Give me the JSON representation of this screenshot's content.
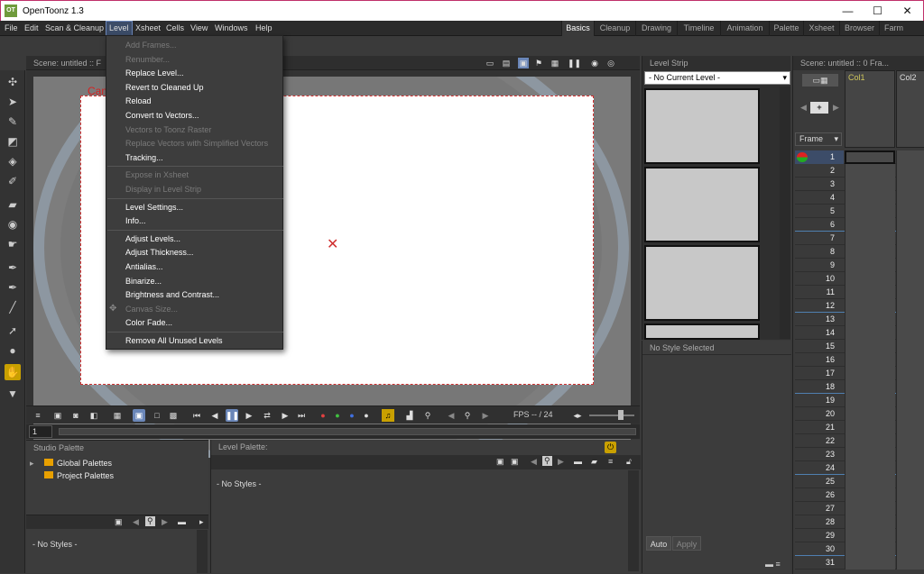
{
  "window": {
    "title": "OpenToonz 1.3",
    "logo": "OT",
    "minimize": "—",
    "maximize": "☐",
    "close": "✕"
  },
  "menubar": {
    "items": [
      "File",
      "Edit",
      "Scan & Cleanup",
      "Level",
      "Xsheet",
      "Cells",
      "View",
      "Windows",
      "Help"
    ],
    "active": "Level",
    "rooms": [
      "Basics",
      "Cleanup",
      "Drawing",
      "Timeline",
      "Animation",
      "Palette",
      "Xsheet",
      "Browser",
      "Farm"
    ],
    "active_room": "Basics"
  },
  "level_menu": {
    "groups": [
      [
        {
          "label": "Add Frames...",
          "enabled": false
        },
        {
          "label": "Renumber...",
          "enabled": false
        },
        {
          "label": "Replace Level...",
          "enabled": true
        },
        {
          "label": "Revert to Cleaned Up",
          "enabled": true
        },
        {
          "label": "Reload",
          "enabled": true
        },
        {
          "label": "Convert to Vectors...",
          "enabled": true
        },
        {
          "label": "Vectors to Toonz Raster",
          "enabled": false
        },
        {
          "label": "Replace Vectors with Simplified Vectors",
          "enabled": false
        },
        {
          "label": "Tracking...",
          "enabled": true
        }
      ],
      [
        {
          "label": "Expose in Xsheet",
          "enabled": false
        },
        {
          "label": "Display in Level Strip",
          "enabled": false
        }
      ],
      [
        {
          "label": "Level Settings...",
          "enabled": true
        },
        {
          "label": "Info...",
          "enabled": true
        }
      ],
      [
        {
          "label": "Adjust Levels...",
          "enabled": true
        },
        {
          "label": "Adjust Thickness...",
          "enabled": true
        },
        {
          "label": "Antialias...",
          "enabled": true
        },
        {
          "label": "Binarize...",
          "enabled": true
        },
        {
          "label": "Brightness and Contrast...",
          "enabled": true
        },
        {
          "label": "Canvas Size...",
          "enabled": false
        },
        {
          "label": "Color Fade...",
          "enabled": true
        }
      ],
      [
        {
          "label": "Remove All Unused Levels",
          "enabled": true
        }
      ]
    ]
  },
  "viewer": {
    "header_label": "Scene: untitled  ::  F",
    "camera_label": "Came",
    "fps_label": "FPS -- / 24",
    "frame_value": "1"
  },
  "level_strip": {
    "title": "Level Strip",
    "current_level": "- No Current Level -"
  },
  "style_editor": {
    "title": "No Style Selected",
    "auto_label": "Auto",
    "apply_label": "Apply"
  },
  "studio_palette": {
    "title": "Studio Palette",
    "items": [
      "Global Palettes",
      "Project Palettes"
    ],
    "no_styles": "- No Styles -"
  },
  "level_palette": {
    "title": "Level Palette:",
    "no_styles": "- No Styles -"
  },
  "xsheet": {
    "header": "Scene: untitled  ::  0 Fra...",
    "frame_label": "Frame",
    "columns": [
      "Col1",
      "Col2"
    ],
    "rows": [
      "1",
      "2",
      "3",
      "4",
      "5",
      "6",
      "7",
      "8",
      "9",
      "10",
      "11",
      "12",
      "13",
      "14",
      "15",
      "16",
      "17",
      "18",
      "19",
      "20",
      "21",
      "22",
      "23",
      "24",
      "25",
      "26",
      "27",
      "28",
      "29",
      "30",
      "31"
    ],
    "marker_every": 6,
    "current_row": "1"
  },
  "colors": {
    "accent": "#6a86b8",
    "highlight": "#c9a000",
    "camera": "#d82020",
    "folder": "#e8a000"
  }
}
